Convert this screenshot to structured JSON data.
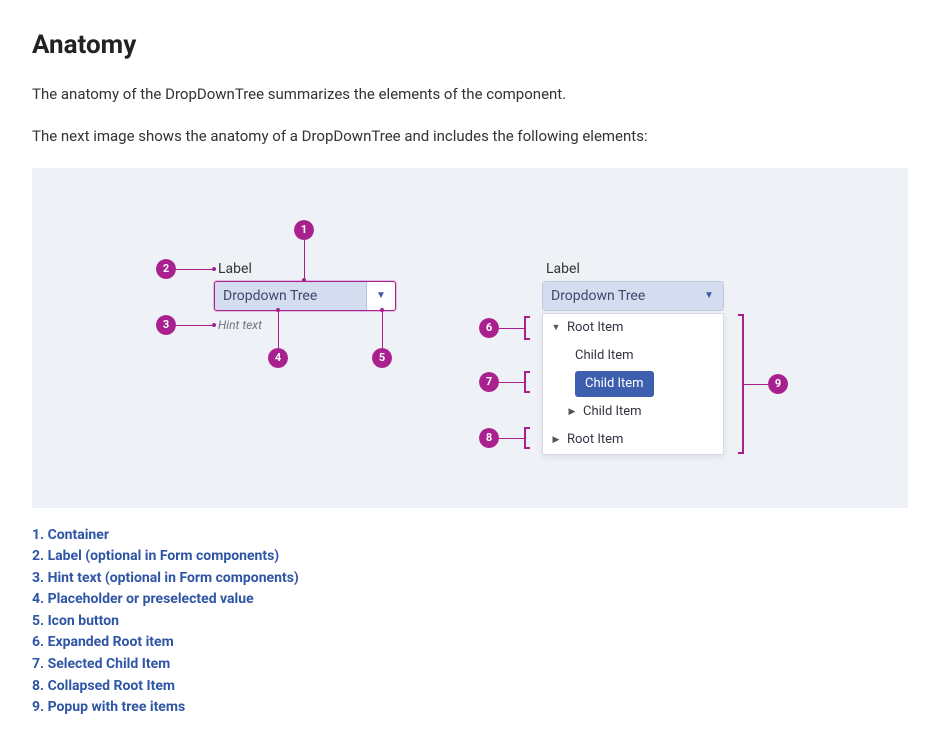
{
  "heading": "Anatomy",
  "paragraph1": "The anatomy of the DropDownTree summarizes the elements of the component.",
  "paragraph2": "The next image shows the anatomy of a DropDownTree and includes the following elements:",
  "markers": {
    "m1": "1",
    "m2": "2",
    "m3": "3",
    "m4": "4",
    "m5": "5",
    "m6": "6",
    "m7": "7",
    "m8": "8",
    "m9": "9"
  },
  "left": {
    "label": "Label",
    "value": "Dropdown Tree",
    "hint": "Hint text"
  },
  "right": {
    "label": "Label",
    "value": "Dropdown Tree",
    "items": {
      "root1": "Root Item",
      "child1": "Child Item",
      "child2_selected": "Child Item",
      "child3": "Child Item",
      "root2": "Root Item"
    }
  },
  "legend": {
    "l1": "1. Container",
    "l2": "2. Label (optional in Form components)",
    "l3": "3. Hint text (optional in Form components)",
    "l4": "4. Placeholder or preselected value",
    "l5": "5. Icon button",
    "l6": "6. Expanded Root item",
    "l7": "7. Selected Child Item",
    "l8": "8. Collapsed Root Item",
    "l9": "9. Popup with tree items"
  }
}
